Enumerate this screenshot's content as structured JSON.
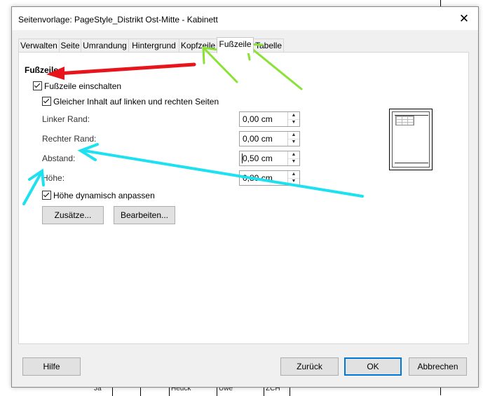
{
  "window": {
    "title": "Seitenvorlage: PageStyle_Distrikt Ost-Mitte - Kabinett",
    "close_glyph": "✕"
  },
  "tabs": [
    {
      "label": "Verwalten"
    },
    {
      "label": "Seite"
    },
    {
      "label": "Umrandung"
    },
    {
      "label": "Hintergrund"
    },
    {
      "label": "Kopfzeile"
    },
    {
      "label": "Fußzeile",
      "active": true
    },
    {
      "label": "Tabelle"
    }
  ],
  "footer_section": {
    "title": "Fußzeile",
    "enable_footer": {
      "label": "Fußzeile einschalten",
      "checked": true
    },
    "same_content": {
      "label": "Gleicher Inhalt auf linken und rechten Seiten",
      "checked": true
    },
    "fields": [
      {
        "label": "Linker Rand:",
        "value": "0,00 cm"
      },
      {
        "label": "Rechter Rand:",
        "value": "0,00 cm"
      },
      {
        "label": "Abstand:",
        "value": "0,50 cm"
      },
      {
        "label": "Höhe:",
        "value": "0,80 cm"
      }
    ],
    "autofit_height": {
      "label": "Höhe dynamisch anpassen",
      "checked": true
    },
    "more_button": "Zusätze...",
    "edit_button": "Bearbeiten..."
  },
  "buttons": {
    "help": "Hilfe",
    "reset": "Zurück",
    "ok": "OK",
    "cancel": "Abbrechen"
  },
  "background_doc": {
    "cells": [
      "Ja",
      "Heuck",
      "Uwe",
      "ZCH"
    ]
  },
  "annotation_colors": {
    "red_arrow": "#e8141b",
    "green_arrows": "#8ae234",
    "cyan_arrows": "#1de1f0"
  }
}
